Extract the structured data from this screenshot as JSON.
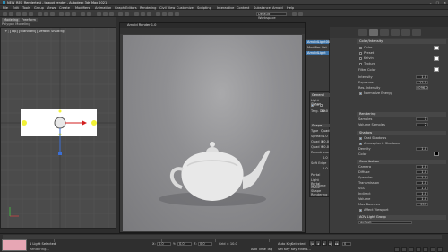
{
  "titlebar": {
    "title": "NEW_REC_Rendertest - teapot render - Autodesk 3ds Max 2021",
    "min": "–",
    "max": "□",
    "close": "×"
  },
  "menu": [
    "File",
    "Edit",
    "Tools",
    "Group",
    "Views",
    "Create",
    "Modifiers",
    "Animation",
    "Graph Editors",
    "Rendering",
    "Civil View",
    "Customize",
    "Scripting",
    "Interactive",
    "Content",
    "Substance",
    "Arnold",
    "Help"
  ],
  "toolbar": {
    "workspace": "Default Workspace"
  },
  "ribbon": {
    "tab1": "Modeling",
    "tab2": "Freeform",
    "subtitle": "Polygon Modeling"
  },
  "viewport": {
    "label": "[+] [Top] [Standard] [Default Shading]"
  },
  "render_window": {
    "title": "Arnold Render 1.0"
  },
  "scene_explorer": {
    "header": "ArnoldLight001",
    "items": [
      "Modifier List",
      "ArnoldLight"
    ]
  },
  "properties": {
    "sections": [
      "Color/Intensity",
      "General",
      "Shape",
      "Rendering",
      "Shadow",
      "Contribution",
      "AOV Light Group"
    ],
    "general": {
      "on_label": "On",
      "targeted_label": "Targeted",
      "targ_dist_label": "Targ. Dist",
      "targ_dist": "30.0",
      "light_shape_label": "Light Shape"
    },
    "color": {
      "color_label": "Color",
      "preset_label": "Preset",
      "kelvin_label": "Kelvin",
      "texture_label": "Texture",
      "filter_label": "Filter Color"
    },
    "intensity": {
      "intensity_label": "Intensity",
      "intensity": "1.0",
      "exposure_label": "Exposure",
      "exposure": "12.0",
      "res_label": "Res. Intensity",
      "res": "4096.0",
      "normalize_label": "Normalize Energy"
    },
    "shape": {
      "type_label": "Type",
      "type": "Quad",
      "spread_label": "Spread",
      "spread": "1.0",
      "width_label": "Quad X",
      "width": "80.0",
      "length_label": "Quad Y",
      "length": "80.0",
      "roundness_label": "Roundness",
      "roundness": "0.0",
      "soft_label": "Soft Edge",
      "soft": "1.0",
      "portal_label": "Portal",
      "light_mode_label": "Light Portal Mode",
      "skydome_label": "Skydome",
      "visibility_label": "Shape Rendering"
    },
    "rendering": {
      "samples_label": "Samples",
      "samples": "1",
      "volume_label": "Volume Samples",
      "volume": "2"
    },
    "shadow": {
      "cast_label": "Cast Shadows",
      "atmos_label": "Atmospheric Shadows",
      "density_label": "Density",
      "density": "1.0",
      "color_label": "Color"
    },
    "contribution": {
      "rows": [
        "Camera",
        "Diffuse",
        "Specular",
        "Transmission",
        "SSS",
        "Indirect",
        "Volume",
        "Max Bounces"
      ],
      "values": [
        "1.0",
        "1.0",
        "1.0",
        "1.0",
        "1.0",
        "1.0",
        "1.0",
        "999"
      ],
      "shadow_label": "Affect Viewport"
    },
    "aov": {
      "group_label": "AOV Light Group",
      "value": "default"
    }
  },
  "status": {
    "selection": "1 Light Selected",
    "rendering": "Rendering...",
    "x_label": "X:",
    "x": "0.0",
    "y_label": "Y:",
    "y": "0.0",
    "z_label": "Z:",
    "z": "0.0",
    "grid": "Grid = 10.0",
    "addtime": "Add Time Tag",
    "auto_key": "Auto Key",
    "selected": "Selected",
    "set_key": "Set Key",
    "key_filters": "Key Filters...",
    "frame": "0"
  },
  "colors": {
    "accent": "#2c8fb8",
    "pink": "#e7a6b4",
    "light_yellow": "#f2f237",
    "arrow_red": "#d21e1e"
  }
}
